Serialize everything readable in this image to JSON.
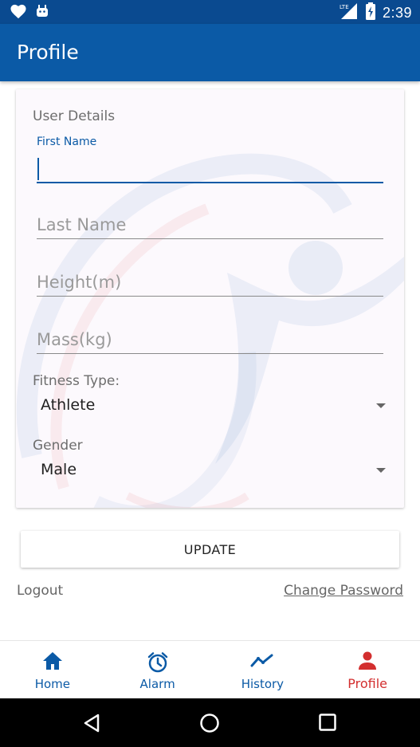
{
  "status_bar": {
    "time": "2:39",
    "icons": [
      "heart-icon",
      "android-icon",
      "lte-signal-icon",
      "battery-charging-icon"
    ]
  },
  "app_bar": {
    "title": "Profile"
  },
  "form": {
    "section_title": "User Details",
    "first_name": {
      "label": "First Name",
      "value": ""
    },
    "last_name": {
      "placeholder": "Last Name",
      "value": ""
    },
    "height": {
      "placeholder": "Height(m)",
      "value": ""
    },
    "mass": {
      "placeholder": "Mass(kg)",
      "value": ""
    },
    "fitness_type": {
      "label": "Fitness Type:",
      "selected": "Athlete"
    },
    "gender": {
      "label": "Gender",
      "selected": "Male"
    }
  },
  "actions": {
    "update_label": "UPDATE",
    "logout_label": "Logout",
    "change_password_label": "Change Password"
  },
  "bottom_nav": {
    "items": [
      {
        "label": "Home",
        "icon": "home-icon",
        "active": false
      },
      {
        "label": "Alarm",
        "icon": "alarm-clock-icon",
        "active": false
      },
      {
        "label": "History",
        "icon": "trending-line-icon",
        "active": false
      },
      {
        "label": "Profile",
        "icon": "person-icon",
        "active": true
      }
    ]
  },
  "colors": {
    "primary": "#0b5aa6",
    "status_bar": "#0a4a90",
    "active_nav": "#d32f2f",
    "card_bg": "#fcf9fd"
  },
  "system_nav": {
    "icons": [
      "back-icon",
      "home-circle-icon",
      "recents-icon"
    ]
  }
}
